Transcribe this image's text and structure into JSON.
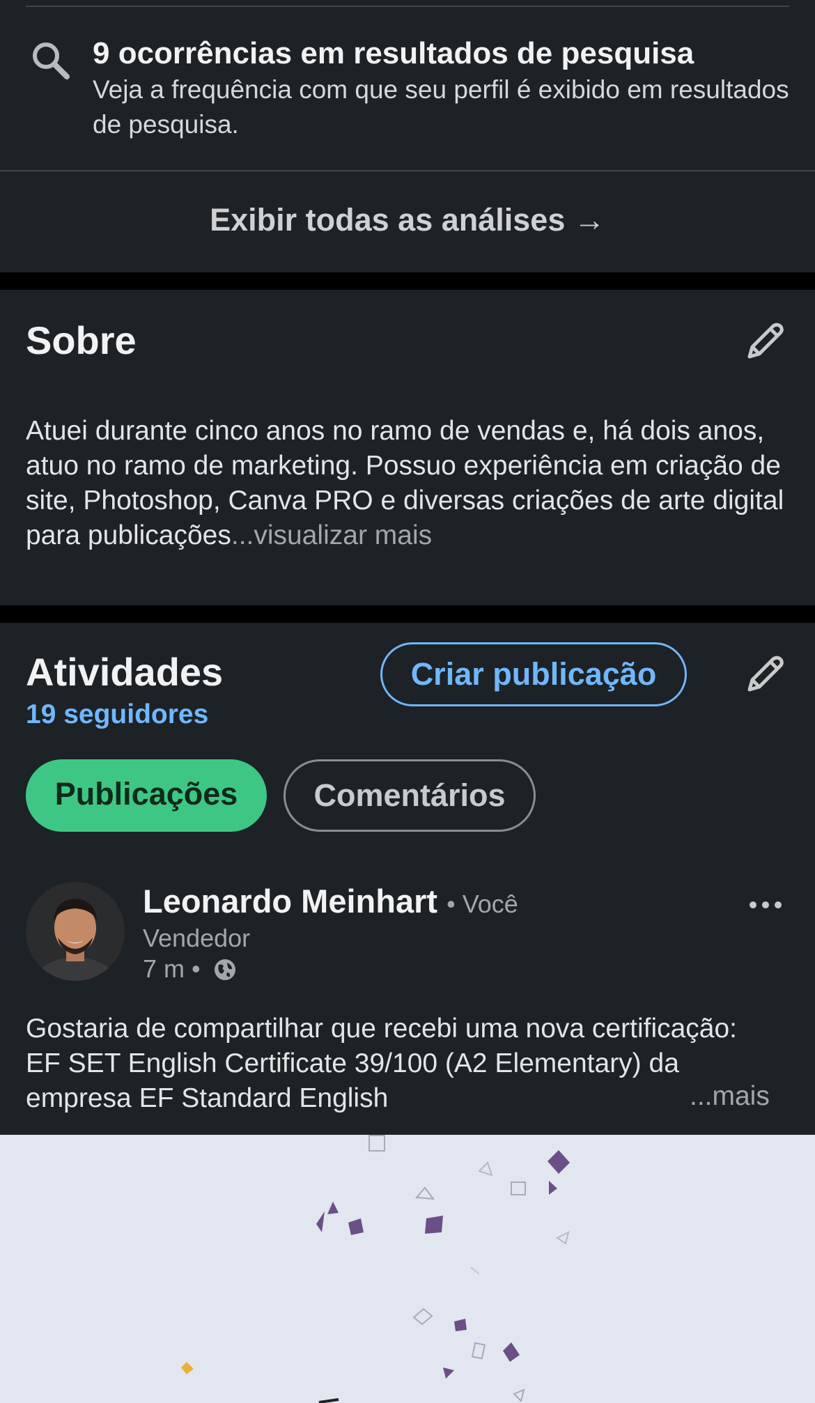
{
  "analytics": {
    "search_appearances_title": "9 ocorrências em resultados de pesquisa",
    "search_appearances_subtitle": "Veja a frequência com que seu perfil é exibido em resultados de pesquisa.",
    "show_all_label": "Exibir todas as análises →",
    "icons": {
      "search": "search-icon"
    }
  },
  "about": {
    "title": "Sobre",
    "text": "Atuei durante cinco anos no ramo  de vendas e, há dois anos, atuo no ramo de marketing. Possuo experiência em criação de site, Photoshop, Canva PRO e diversas criações de arte digital para publicações",
    "see_more_label": "...visualizar mais",
    "icons": {
      "edit": "pencil-icon"
    }
  },
  "activity": {
    "title": "Atividades",
    "followers": "19 seguidores",
    "create_post_label": "Criar publicação",
    "tabs": [
      {
        "label": "Publicações",
        "active": true
      },
      {
        "label": "Comentários",
        "active": false
      }
    ],
    "post": {
      "author": "Leonardo Meinhart",
      "author_tag": "• Você",
      "headline": "Vendedor",
      "time": "7 m •",
      "text": "Gostaria de compartilhar que recebi uma nova certificação: EF SET English Certificate 39/100 (A2 Elementary) da empresa EF Standard English",
      "see_more_label": "...mais",
      "icons": {
        "visibility": "globe-icon",
        "menu": "more-dots-icon"
      }
    }
  },
  "colors": {
    "card_bg": "#1d2226",
    "page_bg": "#000000",
    "accent_blue": "#71b7fb",
    "accent_green": "#3ec784",
    "image_bg": "#e2e6ef",
    "confetti_purple": "#6b4f86",
    "confetti_gold": "#e8b23a"
  }
}
